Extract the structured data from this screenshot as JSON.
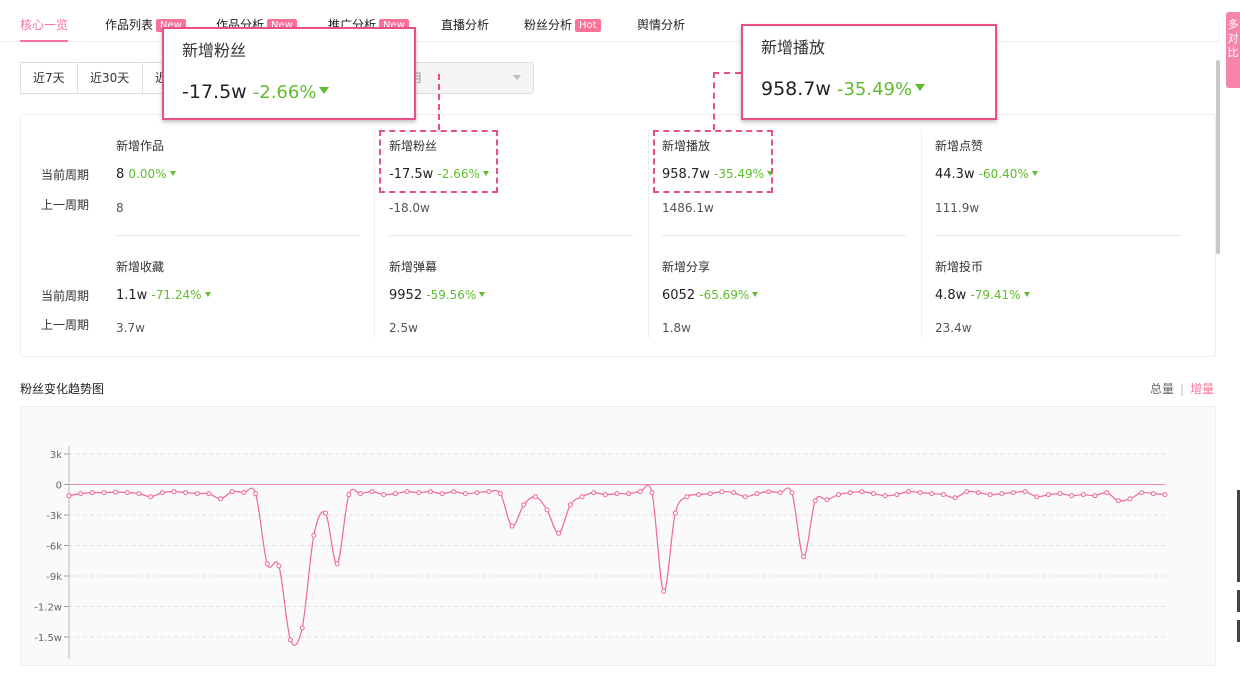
{
  "tabs": [
    {
      "label": "核心一览",
      "active": true,
      "badge": ""
    },
    {
      "label": "作品列表",
      "active": false,
      "badge": "New"
    },
    {
      "label": "作品分析",
      "active": false,
      "badge": "New"
    },
    {
      "label": "推广分析",
      "active": false,
      "badge": "New"
    },
    {
      "label": "直播分析",
      "active": false,
      "badge": ""
    },
    {
      "label": "粉丝分析",
      "active": false,
      "badge": "Hot"
    },
    {
      "label": "舆情分析",
      "active": false,
      "badge": ""
    }
  ],
  "float_tab": {
    "text": "多 对 比"
  },
  "date_filter": {
    "buttons": [
      "近7天",
      "近30天",
      "近"
    ],
    "select_value": "年0月"
  },
  "row_labels": {
    "current": "当前周期",
    "previous": "上一周期"
  },
  "metrics": [
    {
      "title": "新增作品",
      "value": "8",
      "pct": "0.00%",
      "prev": "8"
    },
    {
      "title": "新增粉丝",
      "value": "-17.5w",
      "pct": "-2.66%",
      "prev": "-18.0w"
    },
    {
      "title": "新增播放",
      "value": "958.7w",
      "pct": "-35.49%",
      "prev": "1486.1w"
    },
    {
      "title": "新增点赞",
      "value": "44.3w",
      "pct": "-60.40%",
      "prev": "111.9w"
    },
    {
      "title": "新增收藏",
      "value": "1.1w",
      "pct": "-71.24%",
      "prev": "3.7w"
    },
    {
      "title": "新增弹幕",
      "value": "9952",
      "pct": "-59.56%",
      "prev": "2.5w"
    },
    {
      "title": "新增分享",
      "value": "6052",
      "pct": "-65.69%",
      "prev": "1.8w"
    },
    {
      "title": "新增投币",
      "value": "4.8w",
      "pct": "-79.41%",
      "prev": "23.4w"
    }
  ],
  "callouts": [
    {
      "title": "新增粉丝",
      "value": "-17.5w",
      "pct": "-2.66%"
    },
    {
      "title": "新增播放",
      "value": "958.7w",
      "pct": "-35.49%"
    }
  ],
  "trend": {
    "title": "粉丝变化趋势图",
    "toggle_total": "总量",
    "toggle_incr": "增量"
  },
  "colors": {
    "accent": "#fb7299",
    "positive_change": "#5fbc2d",
    "callout_border": "#e94d8a",
    "area_fill": "#f7a0b6"
  },
  "chart_data": {
    "type": "area",
    "title": "",
    "xlabel": "",
    "ylabel": "",
    "y_ticks": [
      "3k",
      "0",
      "-3k",
      "-6k",
      "-9k",
      "-1.2w",
      "-1.5w"
    ],
    "ylim": [
      -16000,
      4000
    ],
    "grid": true,
    "values": [
      -1100,
      -900,
      -800,
      -800,
      -750,
      -800,
      -900,
      -1200,
      -800,
      -700,
      -800,
      -900,
      -900,
      -1400,
      -700,
      -800,
      -900,
      -7800,
      -8000,
      -15300,
      -14100,
      -5000,
      -2800,
      -7800,
      -1000,
      -900,
      -700,
      -1000,
      -900,
      -700,
      -800,
      -700,
      -900,
      -700,
      -900,
      -800,
      -700,
      -900,
      -4100,
      -2000,
      -1200,
      -2500,
      -4800,
      -2000,
      -1200,
      -800,
      -1000,
      -900,
      -900,
      -700,
      -800,
      -10500,
      -2800,
      -1200,
      -1000,
      -900,
      -700,
      -800,
      -1200,
      -900,
      -700,
      -800,
      -800,
      -7100,
      -1600,
      -1500,
      -1000,
      -800,
      -700,
      -900,
      -1100,
      -1000,
      -700,
      -800,
      -900,
      -1000,
      -1300,
      -700,
      -800,
      -1000,
      -900,
      -800,
      -700,
      -1200,
      -1000,
      -900,
      -1100,
      -1000,
      -1100,
      -800,
      -1600,
      -1400,
      -800,
      -900,
      -1000
    ]
  }
}
